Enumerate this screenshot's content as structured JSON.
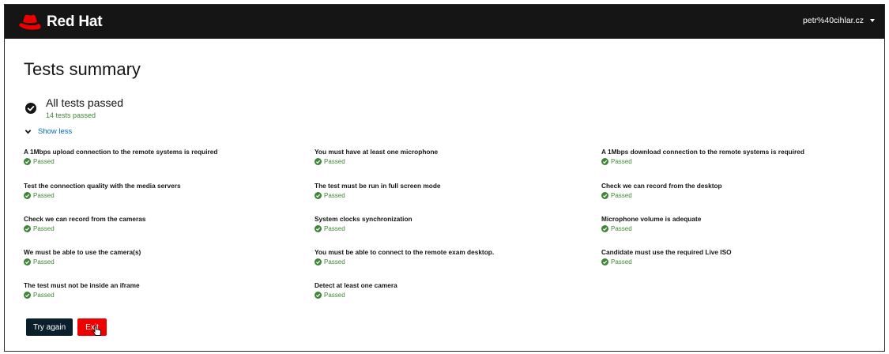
{
  "header": {
    "brand": "Red Hat",
    "logo_icon": "redhat-fedora-logo",
    "user": "petr%40cihlar.cz"
  },
  "page": {
    "title": "Tests summary",
    "summary_title": "All tests passed",
    "summary_count": "14 tests passed",
    "toggle_label": "Show less"
  },
  "tests": [
    {
      "name": "A 1Mbps upload connection to the remote systems is required",
      "status": "Passed"
    },
    {
      "name": "You must have at least one microphone",
      "status": "Passed"
    },
    {
      "name": "A 1Mbps download connection to the remote systems is required",
      "status": "Passed"
    },
    {
      "name": "Test the connection quality with the media servers",
      "status": "Passed"
    },
    {
      "name": "The test must be run in full screen mode",
      "status": "Passed"
    },
    {
      "name": "Check we can record from the desktop",
      "status": "Passed"
    },
    {
      "name": "Check we can record from the cameras",
      "status": "Passed"
    },
    {
      "name": "System clocks synchronization",
      "status": "Passed"
    },
    {
      "name": "Microphone volume is adequate",
      "status": "Passed"
    },
    {
      "name": "We must be able to use the camera(s)",
      "status": "Passed"
    },
    {
      "name": "You must be able to connect to the remote exam desktop.",
      "status": "Passed"
    },
    {
      "name": "Candidate must use the required Live ISO",
      "status": "Passed"
    },
    {
      "name": "The test must not be inside an iframe",
      "status": "Passed"
    },
    {
      "name": "Detect at least one camera",
      "status": "Passed"
    }
  ],
  "buttons": {
    "try_again": "Try again",
    "exit": "Exit"
  },
  "colors": {
    "header_bg": "#151515",
    "brand_red": "#ee0000",
    "success_green": "#3e8635",
    "link_blue": "#0066cc",
    "try_again_bg": "#0a1f2c"
  }
}
